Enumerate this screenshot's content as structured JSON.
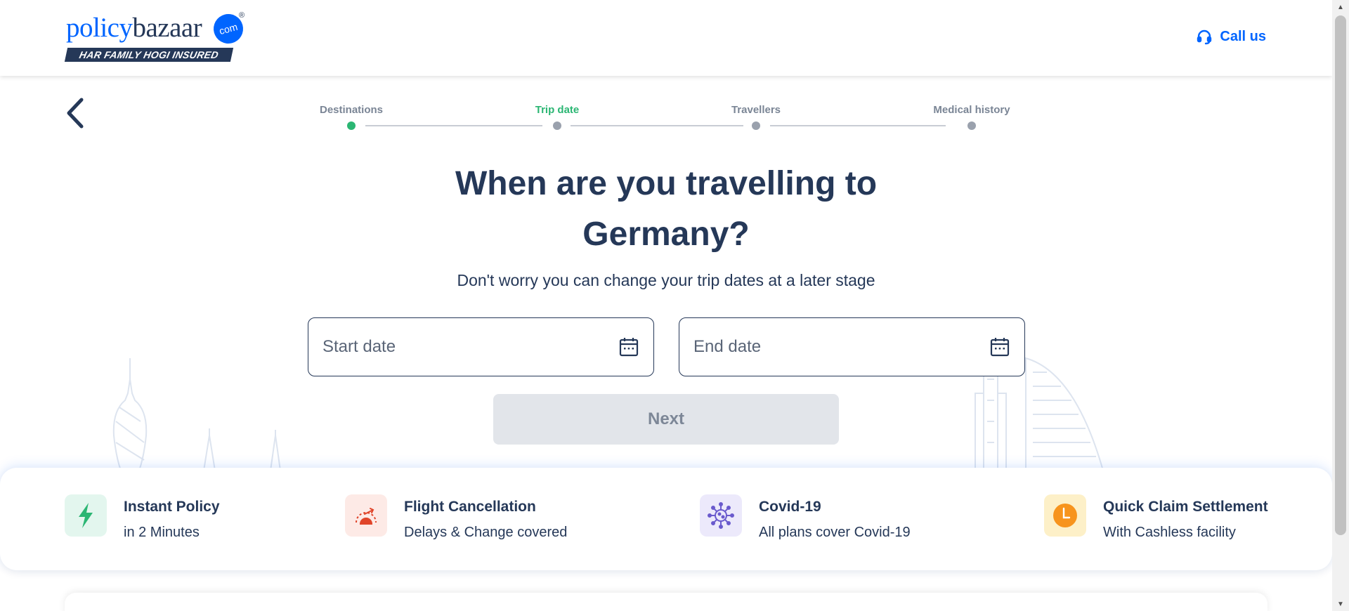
{
  "header": {
    "logo": {
      "word_part1": "policy",
      "word_part2": "bazaar",
      "com": "com",
      "reg": "®",
      "tagline": "HAR FAMILY HOGI INSURED"
    },
    "call_label": "Call us"
  },
  "stepper": {
    "steps": [
      {
        "label": "Destinations",
        "status": "done"
      },
      {
        "label": "Trip date",
        "status": "active"
      },
      {
        "label": "Travellers",
        "status": "pending"
      },
      {
        "label": "Medical history",
        "status": "pending"
      }
    ]
  },
  "main": {
    "title_line1": "When are you travelling to",
    "title_line2": "Germany?",
    "subtitle": "Don't worry you can change your trip dates at a later stage",
    "start_date_placeholder": "Start date",
    "end_date_placeholder": "End date",
    "next_label": "Next"
  },
  "features": [
    {
      "title": "Instant Policy",
      "sub": "in 2 Minutes",
      "icon": "lightning-icon",
      "bg": "#e3f6ee",
      "color": "#2bb673"
    },
    {
      "title": "Flight Cancellation",
      "sub": "Delays & Change covered",
      "icon": "flight-gauge-icon",
      "bg": "#fdeae6",
      "color": "#e0452a"
    },
    {
      "title": "Covid-19",
      "sub": "All plans cover Covid-19",
      "icon": "virus-icon",
      "bg": "#ece9fb",
      "color": "#6a5acd"
    },
    {
      "title": "Quick Claim Settlement",
      "sub": "With Cashless facility",
      "icon": "clock-icon",
      "bg": "#fdf0c8",
      "color": "#f7941d"
    }
  ],
  "colors": {
    "brand_blue": "#0065ff",
    "navy": "#253858",
    "active_green": "#2bb673"
  }
}
